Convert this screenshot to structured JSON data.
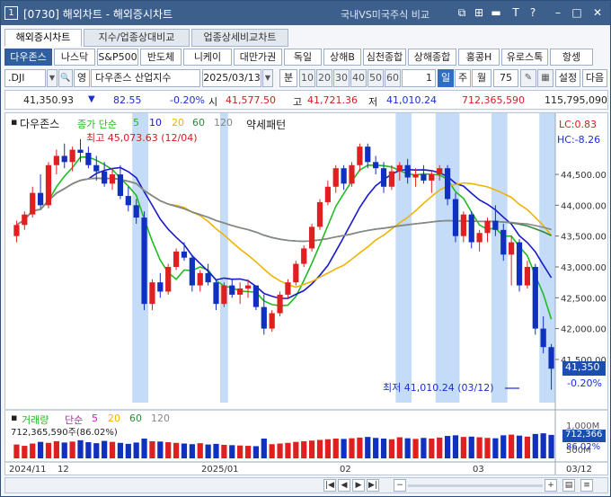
{
  "window": {
    "number": "1",
    "title": "[0730] 해외차트 - 해외증시차트",
    "compare_link": "국내VS미국주식 비교",
    "controls": [
      "⧉",
      "⊞",
      "▬",
      "T",
      "?",
      "–",
      "□",
      "✕"
    ]
  },
  "tabs": [
    {
      "label": "해외증시차트",
      "active": true
    },
    {
      "label": "지수/업종상대비교",
      "active": false
    },
    {
      "label": "업종상세비교차트",
      "active": false
    }
  ],
  "index_buttons": [
    "다우존스",
    "나스닥",
    "S&P500",
    "반도체",
    "니케이",
    "대만가권",
    "독일",
    "상해B",
    "심천종합",
    "상해종합",
    "홍콩H",
    "유로스톡",
    "항셍"
  ],
  "toolbar": {
    "symbol": ".DJI",
    "foreign_btn": "영",
    "name": "다우존스 산업지수",
    "date": "2025/03/13",
    "period_label": "분",
    "minute_options": [
      "10",
      "20",
      "30",
      "40",
      "50",
      "60"
    ],
    "period_num": "1",
    "day": "일",
    "week": "주",
    "month": "월",
    "count": "75",
    "settings": "설정",
    "next": "다음"
  },
  "quote": {
    "last": "41,350.93",
    "arrow": "▼",
    "change": "82.55",
    "pct": "-0.20%",
    "open_label": "시",
    "open": "41,577.50",
    "high_label": "고",
    "high": "41,721.36",
    "low_label": "저",
    "low": "41,010.24",
    "value": "712,365,590",
    "volume": "115,795,090"
  },
  "chart_data": {
    "type": "candlestick",
    "title": "다우존스",
    "ma_legend": {
      "label": "종가 단순",
      "periods": [
        "5",
        "10",
        "20",
        "60",
        "120"
      ],
      "colors": [
        "#22bb22",
        "#1a1acc",
        "#f0b400",
        "#2f8a3b",
        "#888888"
      ]
    },
    "pattern_label": "약세패턴",
    "max_note": "최고 45,073.63 (12/04)",
    "min_note": "최저 41,010.24 (03/12)",
    "lc": "LC:0.83",
    "hc": "HC:-8.26",
    "yticks": [
      "44,500.00",
      "44,000.00",
      "43,500.00",
      "43,000.00",
      "42,500.00",
      "42,000.00",
      "41,500.00"
    ],
    "ylim": [
      40800,
      45200
    ],
    "last_price": "41,350",
    "last_pct": "-0.20%",
    "volume_legend": {
      "label": "거래량",
      "ma": "단순",
      "periods": [
        "5",
        "20",
        "60",
        "120"
      ]
    },
    "volume_value": "712,365,590주(86.02%)",
    "volume_axis": [
      "1,000M",
      "500M"
    ],
    "volume_last": "712,366",
    "volume_last_pct": "86.02%",
    "xlabels": [
      "2024/11",
      "12",
      "2025/01",
      "02",
      "03",
      "03/12"
    ],
    "candles": [
      [
        43500,
        43750,
        43400,
        43680
      ],
      [
        43680,
        43900,
        43600,
        43850
      ],
      [
        43850,
        44300,
        43800,
        44200
      ],
      [
        44200,
        44500,
        43950,
        44000
      ],
      [
        44000,
        44700,
        43950,
        44650
      ],
      [
        44650,
        44900,
        44500,
        44800
      ],
      [
        44800,
        45000,
        44600,
        44700
      ],
      [
        44700,
        44950,
        44550,
        44900
      ],
      [
        44900,
        45073,
        44700,
        44850
      ],
      [
        44850,
        44950,
        44600,
        44650
      ],
      [
        44650,
        44800,
        44400,
        44550
      ],
      [
        44550,
        44700,
        44300,
        44350
      ],
      [
        44350,
        44600,
        44250,
        44500
      ],
      [
        44500,
        44650,
        44100,
        44150
      ],
      [
        44150,
        44300,
        43900,
        44000
      ],
      [
        44000,
        44100,
        43700,
        43800
      ],
      [
        43800,
        43900,
        42300,
        42400
      ],
      [
        42400,
        42800,
        42300,
        42750
      ],
      [
        42750,
        42900,
        42500,
        42600
      ],
      [
        42600,
        43050,
        42550,
        43000
      ],
      [
        43000,
        43300,
        42950,
        43250
      ],
      [
        43250,
        43400,
        43100,
        43150
      ],
      [
        43150,
        43200,
        42600,
        42700
      ],
      [
        42700,
        42950,
        42600,
        42900
      ],
      [
        42900,
        43050,
        42700,
        42750
      ],
      [
        42750,
        42800,
        42300,
        42400
      ],
      [
        42400,
        42750,
        42350,
        42700
      ],
      [
        42700,
        42800,
        42500,
        42550
      ],
      [
        42550,
        42750,
        42400,
        42650
      ],
      [
        42650,
        42800,
        42500,
        42700
      ],
      [
        42700,
        42700,
        42300,
        42350
      ],
      [
        42350,
        42550,
        41900,
        42000
      ],
      [
        42000,
        42300,
        41950,
        42250
      ],
      [
        42250,
        42600,
        42200,
        42550
      ],
      [
        42550,
        42800,
        42500,
        42750
      ],
      [
        42750,
        43100,
        42700,
        43050
      ],
      [
        43050,
        43350,
        43000,
        43300
      ],
      [
        43300,
        43700,
        43250,
        43650
      ],
      [
        43650,
        44100,
        43600,
        44050
      ],
      [
        44050,
        44400,
        44000,
        44300
      ],
      [
        44300,
        44650,
        44200,
        44600
      ],
      [
        44600,
        44650,
        44250,
        44350
      ],
      [
        44350,
        44700,
        44300,
        44650
      ],
      [
        44650,
        45000,
        44550,
        44950
      ],
      [
        44950,
        45000,
        44600,
        44700
      ],
      [
        44700,
        44800,
        44500,
        44600
      ],
      [
        44600,
        44700,
        44200,
        44300
      ],
      [
        44300,
        44650,
        44250,
        44550
      ],
      [
        44550,
        44700,
        44400,
        44650
      ],
      [
        44650,
        44750,
        44350,
        44450
      ],
      [
        44450,
        44600,
        44300,
        44500
      ],
      [
        44500,
        44650,
        44350,
        44400
      ],
      [
        44400,
        44550,
        44200,
        44500
      ],
      [
        44500,
        44650,
        44400,
        44600
      ],
      [
        44600,
        44650,
        44000,
        44100
      ],
      [
        44100,
        44200,
        43400,
        43500
      ],
      [
        43500,
        43900,
        43400,
        43850
      ],
      [
        43850,
        43900,
        43300,
        43400
      ],
      [
        43400,
        43600,
        43250,
        43550
      ],
      [
        43550,
        43800,
        43400,
        43750
      ],
      [
        43750,
        44000,
        43500,
        43600
      ],
      [
        43600,
        43700,
        43100,
        43200
      ],
      [
        43200,
        43500,
        42700,
        43400
      ],
      [
        43400,
        43450,
        42600,
        42700
      ],
      [
        42700,
        43100,
        42650,
        43000
      ],
      [
        43000,
        43050,
        41900,
        42000
      ],
      [
        42000,
        42200,
        41600,
        41700
      ],
      [
        41700,
        41750,
        41010,
        41350
      ]
    ],
    "volumes": [
      420,
      380,
      450,
      500,
      470,
      520,
      480,
      510,
      550,
      490,
      460,
      530,
      500,
      470,
      440,
      480,
      600,
      520,
      510,
      490,
      470,
      450,
      430,
      460,
      420,
      440,
      410,
      400,
      390,
      380,
      370,
      600,
      430,
      450,
      470,
      500,
      520,
      540,
      560,
      580,
      600,
      590,
      610,
      630,
      650,
      620,
      600,
      580,
      640,
      610,
      590,
      620,
      600,
      630,
      680,
      700,
      650,
      660,
      640,
      620,
      610,
      700,
      720,
      690,
      660,
      740,
      760,
      712
    ]
  }
}
